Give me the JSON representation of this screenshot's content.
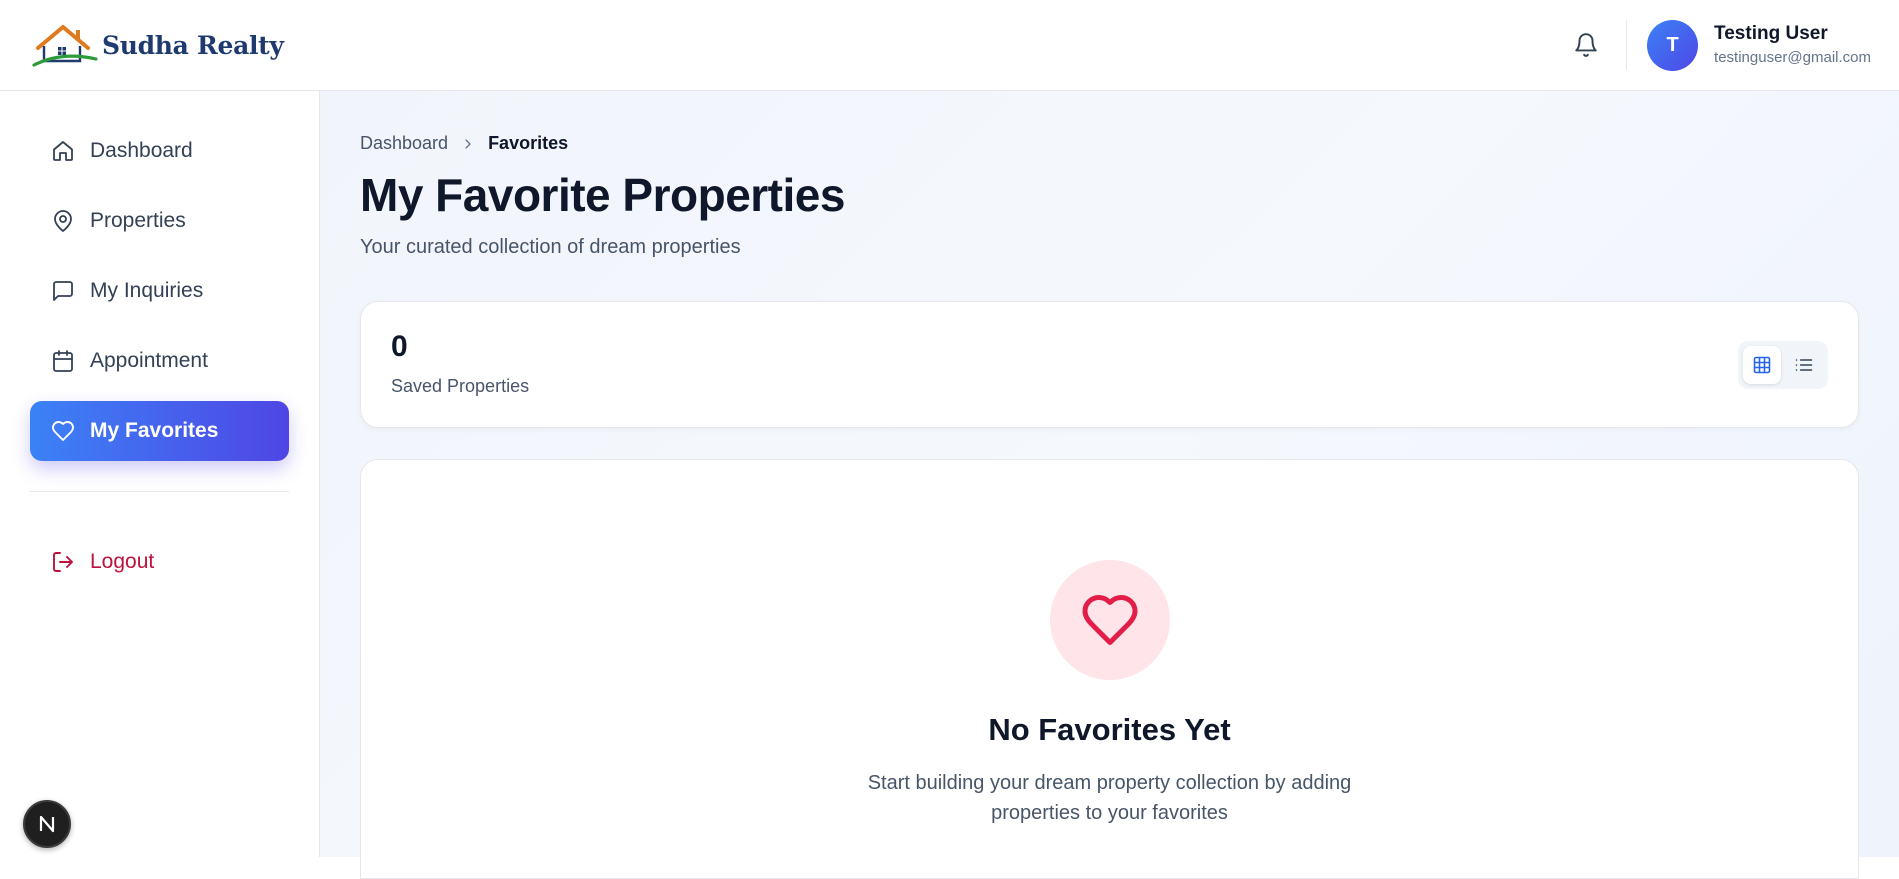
{
  "brand": {
    "name": "Sudha Realty",
    "logo_icon": "house-logo-icon"
  },
  "header": {
    "notification_icon": "bell-icon",
    "user": {
      "avatar_initial": "T",
      "name": "Testing User",
      "email": "testinguser@gmail.com"
    }
  },
  "sidebar": {
    "items": [
      {
        "label": "Dashboard",
        "icon": "home-icon",
        "active": false
      },
      {
        "label": "Properties",
        "icon": "map-pin-icon",
        "active": false
      },
      {
        "label": "My Inquiries",
        "icon": "message-square-icon",
        "active": false
      },
      {
        "label": "Appointment",
        "icon": "calendar-icon",
        "active": false
      },
      {
        "label": "My Favorites",
        "icon": "heart-icon",
        "active": true
      }
    ],
    "logout_label": "Logout",
    "dev_badge": "N"
  },
  "main": {
    "breadcrumb": {
      "parent": "Dashboard",
      "current": "Favorites"
    },
    "title": "My Favorite Properties",
    "subtitle": "Your curated collection of dream properties",
    "stats": {
      "count": "0",
      "label": "Saved Properties"
    },
    "view_toggle": {
      "selected": "grid",
      "options": [
        "grid",
        "list"
      ]
    },
    "empty_state": {
      "title": "No Favorites Yet",
      "description": "Start building your dream property collection by adding properties to your favorites"
    }
  },
  "colors": {
    "accent_start": "#3b82f6",
    "accent_end": "#4f46e5",
    "logout": "#be123c",
    "heart": "#e11d48",
    "heart_bg": "#ffe4ea"
  }
}
